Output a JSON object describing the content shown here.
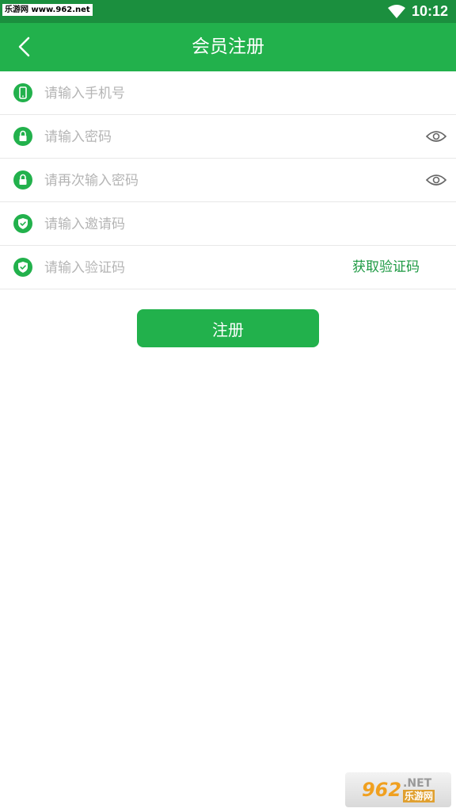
{
  "status_bar": {
    "watermark": "乐游网 www.962.net",
    "time": "10:12"
  },
  "toolbar": {
    "title": "会员注册"
  },
  "form": {
    "phone_placeholder": "请输入手机号",
    "password_placeholder": "请输入密码",
    "confirm_placeholder": "请再次输入密码",
    "invite_placeholder": "请输入邀请码",
    "code_placeholder": "请输入验证码",
    "get_code_label": "获取验证码"
  },
  "register_label": "注册",
  "watermark_bottom": {
    "num": "962",
    "net": ".NET",
    "cn": "乐游网"
  },
  "colors": {
    "primary": "#22b14c",
    "status_bar": "#1b8f3e",
    "link": "#1f9a44"
  }
}
